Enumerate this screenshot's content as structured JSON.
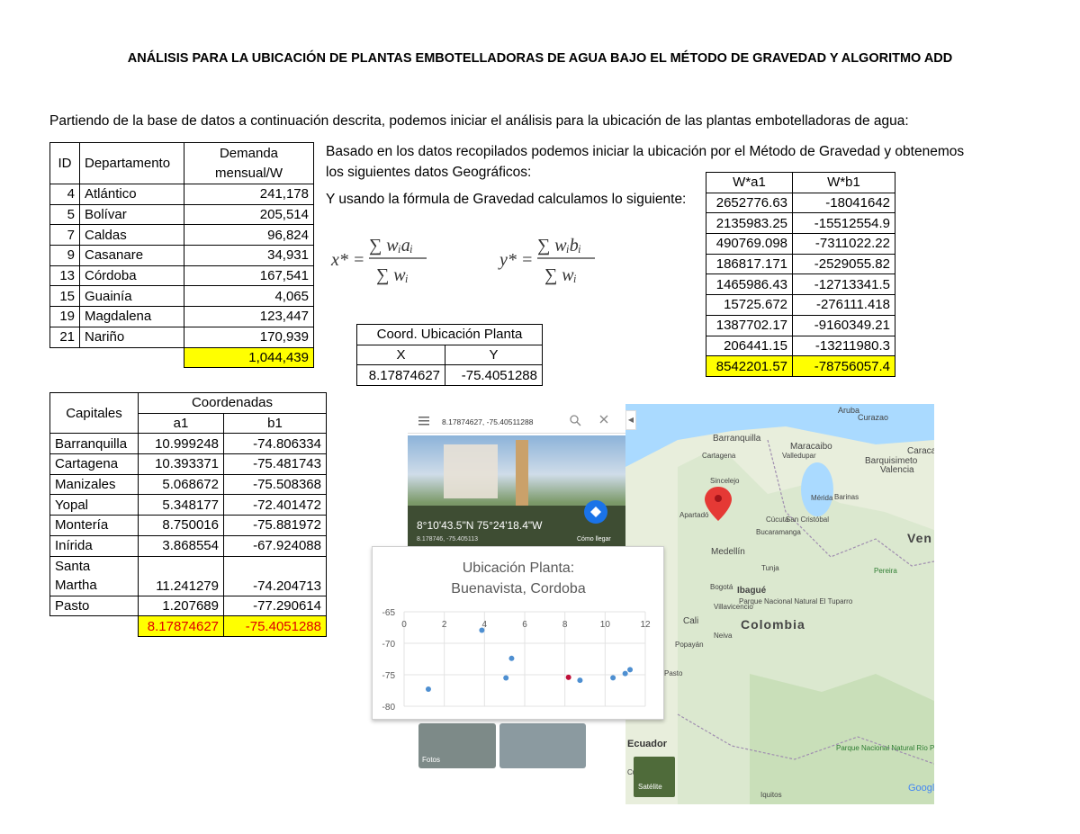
{
  "title": "ANÁLISIS PARA LA UBICACIÓN DE PLANTAS EMBOTELLADORAS DE AGUA BAJO EL MÉTODO DE GRAVEDAD Y ALGORITMO ADD",
  "intro": "Partiendo de la base de datos a continuación descrita, podemos iniciar el análisis para la ubicación de las plantas embotelladoras de agua:",
  "demand_table": {
    "headers": {
      "id": "ID",
      "dept": "Departamento",
      "demand_l1": "Demanda",
      "demand_l2": "mensual/W"
    },
    "rows": [
      {
        "id": "4",
        "dept": "Atlántico",
        "demand": "241,178"
      },
      {
        "id": "5",
        "dept": "Bolívar",
        "demand": "205,514"
      },
      {
        "id": "7",
        "dept": "Caldas",
        "demand": "96,824"
      },
      {
        "id": "9",
        "dept": "Casanare",
        "demand": "34,931"
      },
      {
        "id": "13",
        "dept": "Córdoba",
        "demand": "167,541"
      },
      {
        "id": "15",
        "dept": "Guainía",
        "demand": "4,065"
      },
      {
        "id": "19",
        "dept": "Magdalena",
        "demand": "123,447"
      },
      {
        "id": "21",
        "dept": "Nariño",
        "demand": "170,939"
      }
    ],
    "total": "1,044,439"
  },
  "capitals_table": {
    "headers": {
      "capitals": "Capitales",
      "coords": "Coordenadas",
      "a1": "a1",
      "b1": "b1"
    },
    "rows": [
      {
        "name": "Barranquilla",
        "a1": "10.999248",
        "b1": "-74.806334"
      },
      {
        "name": "Cartagena",
        "a1": "10.393371",
        "b1": "-75.481743"
      },
      {
        "name": "Manizales",
        "a1": "5.068672",
        "b1": "-75.508368"
      },
      {
        "name": "Yopal",
        "a1": "5.348177",
        "b1": "-72.401472"
      },
      {
        "name": "Montería",
        "a1": "8.750016",
        "b1": "-75.881972"
      },
      {
        "name": "Inírida",
        "a1": "3.868554",
        "b1": "-67.924088"
      },
      {
        "name_l1": "Santa",
        "name_l2": "Martha",
        "a1": "11.241279",
        "b1": "-74.204713"
      },
      {
        "name": "Pasto",
        "a1": "1.207689",
        "b1": "-77.290614"
      }
    ],
    "result": {
      "a1": "8.17874627",
      "b1": "-75.4051288"
    }
  },
  "para1": "Basado en los datos recopilados podemos iniciar la ubicación por el Método de Gravedad y obtenemos los siguientes datos Geográficos:",
  "para2": "Y usando la fórmula de Gravedad calculamos lo siguiente:",
  "formula": {
    "x_lhs": "x* =",
    "x_num": "∑ wᵢaᵢ",
    "x_den": "∑ wᵢ",
    "y_lhs": "y* =",
    "y_num": "∑ wᵢbᵢ",
    "y_den": "∑ wᵢ"
  },
  "w_table": {
    "headers": {
      "wa": "W*a1",
      "wb": "W*b1"
    },
    "rows": [
      {
        "wa": "2652776.63",
        "wb": "-18041642"
      },
      {
        "wa": "2135983.25",
        "wb": "-15512554.9"
      },
      {
        "wa": "490769.098",
        "wb": "-7311022.22"
      },
      {
        "wa": "186817.171",
        "wb": "-2529055.82"
      },
      {
        "wa": "1465986.43",
        "wb": "-12713341.5"
      },
      {
        "wa": "15725.672",
        "wb": "-276111.418"
      },
      {
        "wa": "1387702.17",
        "wb": "-9160349.21"
      },
      {
        "wa": "206441.15",
        "wb": "-13211980.3"
      }
    ],
    "total": {
      "wa": "8542201.57",
      "wb": "-78756057.4"
    }
  },
  "coord_table": {
    "header": "Coord. Ubicación Planta",
    "x_label": "X",
    "y_label": "Y",
    "x": "8.17874627",
    "y": "-75.4051288"
  },
  "map": {
    "search_text": "8.17874627, -75.40511288",
    "dms": "8°10'43.5\"N 75°24'18.4\"W",
    "decimal": "8.178746, -75.405113",
    "directions": "Cómo llegar",
    "photos_label": "Fotos",
    "satellite_label": "Satélite",
    "google": "Google",
    "places": [
      "Aruba",
      "Curazao",
      "Barranquilla",
      "Cartagena",
      "Maracaibo",
      "Valledupar",
      "Barquisimeto",
      "Valencia",
      "Caracas",
      "Sincelejo",
      "Mérida",
      "Barinas",
      "Apartadó",
      "Cúcuta",
      "San Cristóbal",
      "Bucaramanga",
      "Medellín",
      "Ven",
      "Tunja",
      "Pereira",
      "Bogotá",
      "Ibagué",
      "Villavicencio",
      "Parque Nacional Natural El Tuparro",
      "Cali",
      "Neiva",
      "Popayán",
      "Colombia",
      "Pasto",
      "Ecuador",
      "Parque Nacional Natural Río Puré",
      "Iquitos",
      "Cuen"
    ],
    "marker_color": "#e53935"
  },
  "chart_data": {
    "type": "scatter",
    "title_l1": "Ubicación Planta:",
    "title_l2": "Buenavista, Cordoba",
    "xlim": [
      0,
      12
    ],
    "ylim": [
      -80,
      -65
    ],
    "x_ticks": [
      "0",
      "2",
      "4",
      "6",
      "8",
      "10",
      "12"
    ],
    "y_ticks": [
      "-65",
      "-70",
      "-75",
      "-80"
    ],
    "grid": true,
    "series": [
      {
        "color": "#4e8fd1",
        "points": [
          [
            10.999248,
            -74.806334
          ],
          [
            10.393371,
            -75.481743
          ],
          [
            5.068672,
            -75.508368
          ],
          [
            5.348177,
            -72.401472
          ],
          [
            8.750016,
            -75.881972
          ],
          [
            3.868554,
            -67.924088
          ],
          [
            11.241279,
            -74.204713
          ],
          [
            1.207689,
            -77.290614
          ]
        ]
      },
      {
        "color": "#c0103a",
        "points": [
          [
            8.17874627,
            -75.4051288
          ]
        ]
      }
    ]
  }
}
